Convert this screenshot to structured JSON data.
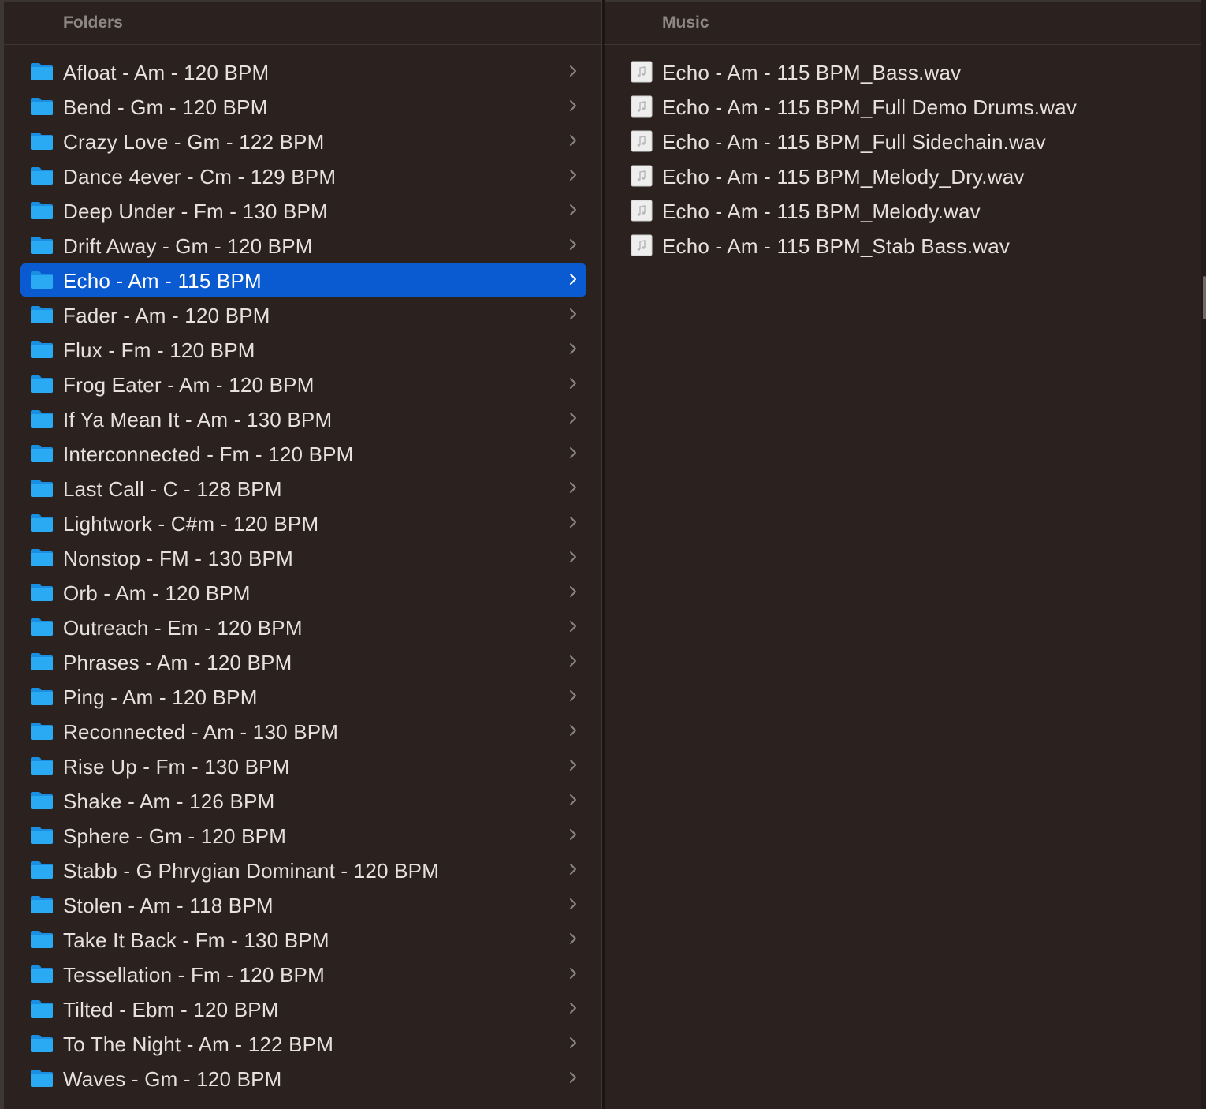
{
  "folders_column": {
    "header": "Folders",
    "items": [
      {
        "label": "Afloat - Am - 120 BPM"
      },
      {
        "label": "Bend - Gm - 120 BPM"
      },
      {
        "label": "Crazy Love - Gm - 122 BPM"
      },
      {
        "label": "Dance 4ever - Cm - 129 BPM"
      },
      {
        "label": "Deep Under - Fm - 130 BPM"
      },
      {
        "label": "Drift Away - Gm - 120 BPM"
      },
      {
        "label": "Echo - Am - 115 BPM",
        "selected": true
      },
      {
        "label": "Fader - Am - 120 BPM"
      },
      {
        "label": "Flux - Fm - 120 BPM"
      },
      {
        "label": "Frog Eater - Am - 120 BPM"
      },
      {
        "label": "If Ya Mean It - Am - 130 BPM"
      },
      {
        "label": "Interconnected - Fm - 120 BPM"
      },
      {
        "label": "Last Call - C - 128 BPM"
      },
      {
        "label": "Lightwork - C#m - 120 BPM"
      },
      {
        "label": "Nonstop - FM - 130 BPM"
      },
      {
        "label": "Orb - Am - 120 BPM"
      },
      {
        "label": "Outreach - Em - 120 BPM"
      },
      {
        "label": "Phrases - Am - 120 BPM"
      },
      {
        "label": "Ping - Am - 120 BPM"
      },
      {
        "label": "Reconnected - Am - 130 BPM"
      },
      {
        "label": "Rise Up - Fm - 130 BPM"
      },
      {
        "label": "Shake - Am - 126 BPM"
      },
      {
        "label": "Sphere - Gm - 120 BPM"
      },
      {
        "label": "Stabb - G Phrygian Dominant - 120 BPM"
      },
      {
        "label": "Stolen - Am - 118 BPM"
      },
      {
        "label": "Take It Back - Fm - 130 BPM"
      },
      {
        "label": "Tessellation - Fm - 120 BPM"
      },
      {
        "label": "Tilted - Ebm - 120 BPM"
      },
      {
        "label": "To The Night - Am - 122 BPM"
      },
      {
        "label": "Waves - Gm - 120 BPM"
      }
    ]
  },
  "music_column": {
    "header": "Music",
    "items": [
      {
        "label": "Echo - Am - 115 BPM_Bass.wav"
      },
      {
        "label": "Echo - Am - 115 BPM_Full Demo Drums.wav"
      },
      {
        "label": "Echo - Am - 115 BPM_Full Sidechain.wav"
      },
      {
        "label": "Echo - Am - 115 BPM_Melody_Dry.wav"
      },
      {
        "label": "Echo - Am - 115 BPM_Melody.wav"
      },
      {
        "label": "Echo - Am - 115 BPM_Stab Bass.wav"
      }
    ]
  },
  "icons": {
    "folder": "folder-icon",
    "file": "audio-file-icon",
    "chevron": "chevron-right-icon"
  },
  "colors": {
    "background": "#2b2220",
    "selection": "#0a5bd2",
    "folder": "#1ea0f0",
    "text": "#e6e1df",
    "header_text": "#8d8785"
  }
}
